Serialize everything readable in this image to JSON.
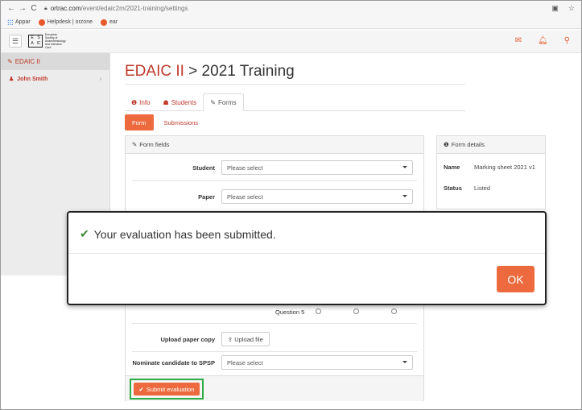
{
  "browser": {
    "url_host": "ortrac.com",
    "url_path": "/event/edaic2m/2021-training/settings",
    "back_glyph": "←",
    "forward_glyph": "→",
    "reload_glyph": "C"
  },
  "bookmarks": [
    {
      "label": "Appar"
    },
    {
      "label": "Helpdesk | orzone"
    },
    {
      "label": "ear"
    }
  ],
  "logo": {
    "letters": [
      "E",
      "S",
      "A",
      "IC"
    ],
    "caption": "European Society of Anaesthesiology and Intensive Care"
  },
  "sidebar": {
    "items": [
      {
        "label": "EDAIC II"
      },
      {
        "label": "John Smith"
      }
    ]
  },
  "page": {
    "title_brand": "EDAIC II",
    "title_rest": " > 2021 Training",
    "tabs": [
      {
        "label": "Info"
      },
      {
        "label": "Students"
      },
      {
        "label": "Forms"
      }
    ],
    "pills": [
      {
        "label": "Form"
      },
      {
        "label": "Submissions"
      }
    ]
  },
  "form_panel": {
    "header": "Form fields",
    "student_label": "Student",
    "student_value": "Please select",
    "paper_label": "Paper",
    "paper_value": "Please select",
    "question5_label": "Question 5",
    "upload_label": "Upload paper copy",
    "upload_button": "Upload file",
    "nominate_label": "Nominate candidate to SPSP",
    "nominate_value": "Please select",
    "submit_button": "Submit evaluation"
  },
  "details_panel": {
    "header": "Form details",
    "name_key": "Name",
    "name_value": "Marking sheet 2021 v1",
    "status_key": "Status",
    "status_value": "Listed"
  },
  "modal": {
    "message": "Your evaluation has been submitted.",
    "ok_label": "OK"
  },
  "colors": {
    "accent": "#ec6a3e",
    "brand_red": "#c0392b",
    "highlight_green": "#2eaa47",
    "success_check": "#3c8a3c"
  }
}
